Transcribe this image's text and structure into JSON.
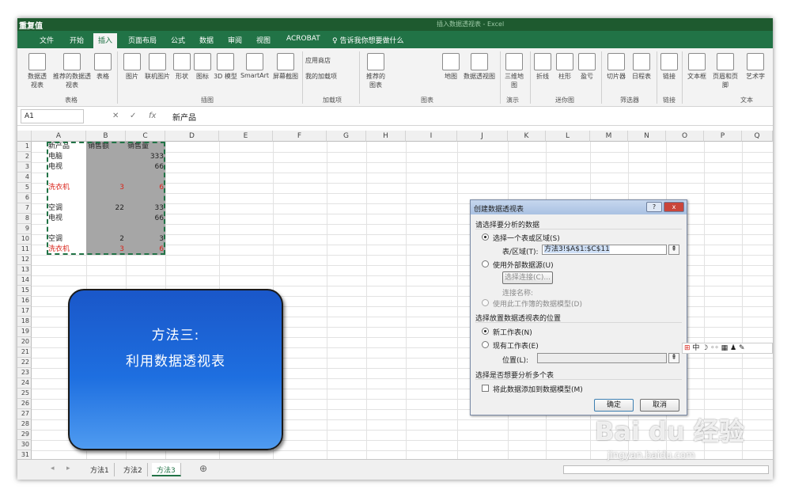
{
  "window": {
    "title": "重复值",
    "center_title": "插入数据透视表 - Excel"
  },
  "tabs": [
    "文件",
    "开始",
    "插入",
    "页面布局",
    "公式",
    "数据",
    "审阅",
    "视图",
    "ACROBAT",
    "♀ 告诉我你想要做什么"
  ],
  "active_tab": "插入",
  "ribbon": {
    "buttons": [
      "数据透视表",
      "推荐的数据透视表",
      "表格",
      "图片",
      "联机图片",
      "形状",
      "图标",
      "3D 模型",
      "SmartArt",
      "屏幕截图",
      "应用商店",
      "我的加载项",
      "推荐的图表",
      "地图",
      "数据透视图",
      "三维地图",
      "折线",
      "柱形",
      "盈亏",
      "切片器",
      "日程表",
      "链接",
      "文本框",
      "页眉和页脚",
      "艺术字"
    ],
    "groups": [
      "表格",
      "插图",
      "加载项",
      "图表",
      "演示",
      "迷你图",
      "筛选器",
      "链接",
      "文本"
    ]
  },
  "formula_bar": {
    "name_box": "A1",
    "fx": "fx",
    "content": "新产品"
  },
  "columns": [
    "A",
    "B",
    "C",
    "D",
    "E",
    "F",
    "G",
    "H",
    "I",
    "J",
    "K",
    "L",
    "M",
    "N",
    "O",
    "P",
    "Q"
  ],
  "rows": [
    "1",
    "2",
    "3",
    "4",
    "5",
    "6",
    "7",
    "8",
    "9",
    "10",
    "11",
    "12",
    "13",
    "14",
    "15",
    "16",
    "17",
    "18",
    "19",
    "20",
    "21",
    "22",
    "23",
    "24",
    "25",
    "26",
    "27",
    "28",
    "29",
    "30",
    "31"
  ],
  "cells": {
    "r1": [
      "新产品",
      "销售额",
      "销售量"
    ],
    "r2": [
      "电脑",
      "",
      "333"
    ],
    "r3": [
      "电视",
      "",
      "66"
    ],
    "r5": [
      "洗衣机",
      "3",
      "6"
    ],
    "r7": [
      "空调",
      "22",
      "33"
    ],
    "r8": [
      "电视",
      "",
      "66"
    ],
    "r10": [
      "空调",
      "2",
      "3"
    ],
    "r11": [
      "洗衣机",
      "3",
      "6"
    ]
  },
  "callout": {
    "line1": "方法三:",
    "line2": "利用数据透视表"
  },
  "dialog": {
    "title": "创建数据透视表",
    "help": "?",
    "close": "x",
    "section1": "请选择要分析的数据",
    "opt_range": "选择一个表或区域(S)",
    "range_label": "表/区域(T):",
    "range_value": "方法3!$A$1:$C$11",
    "opt_external": "使用外部数据源(U)",
    "choose_conn": "选择连接(C)...",
    "conn_name": "连接名称:",
    "opt_datamodel": "使用此工作簿的数据模型(D)",
    "section2": "选择放置数据透视表的位置",
    "opt_new": "新工作表(N)",
    "opt_existing": "现有工作表(E)",
    "location_label": "位置(L):",
    "location_value": "",
    "section3": "选择是否想要分析多个表",
    "add_model": "将此数据添加到数据模型(M)",
    "ok": "确定",
    "cancel": "取消"
  },
  "sheets": [
    "方法1",
    "方法2",
    "方法3"
  ],
  "active_sheet": "方法3",
  "ime_bar": "中 ☽ ◦◦ ▦ ♟ ✎",
  "watermark": {
    "logo": "Bai du 经验",
    "url": "jingyan.baidu.com"
  },
  "colors": {
    "excel_green": "#217346",
    "callout_blue": "#1e6fe0",
    "red_text": "#d9261c"
  }
}
